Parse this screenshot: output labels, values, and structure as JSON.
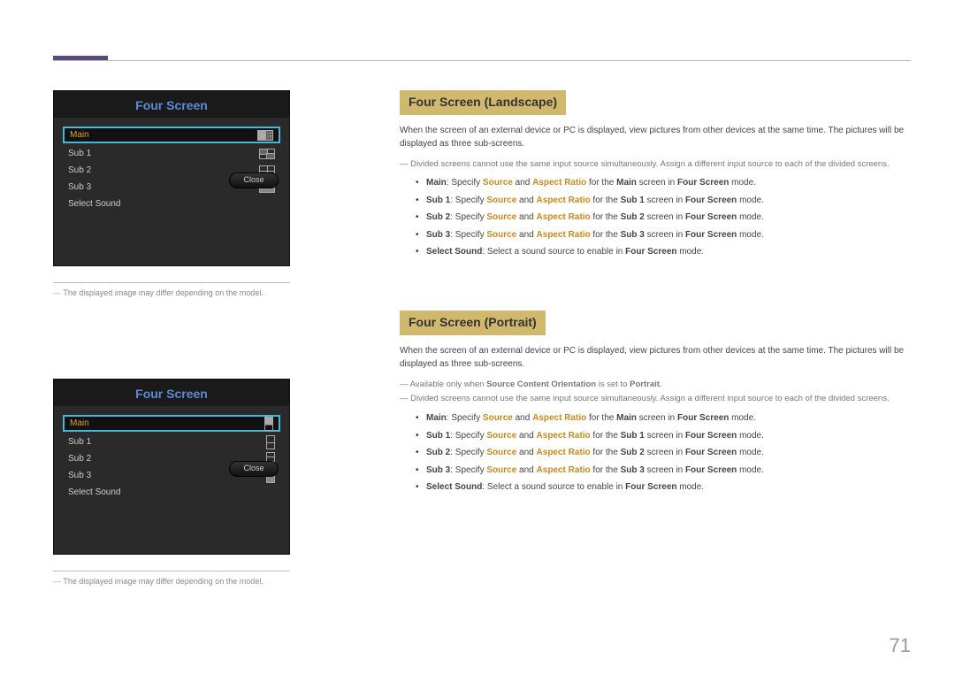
{
  "page_number": "71",
  "osd": {
    "title": "Four Screen",
    "rows": [
      "Main",
      "Sub 1",
      "Sub 2",
      "Sub 3",
      "Select Sound"
    ],
    "close": "Close"
  },
  "caption": "The displayed image may differ depending on the model.",
  "landscape": {
    "heading": "Four Screen (Landscape)",
    "intro": "When the screen of an external device or PC is displayed, view pictures from other devices at the same time. The pictures will be displayed as three sub-screens.",
    "note1": "Divided screens cannot use the same input source simultaneously. Assign a different input source to each of the divided screens.",
    "items": {
      "main_l": "Main",
      "main_t1": ": Specify ",
      "src": "Source",
      "and": " and ",
      "ar": "Aspect Ratio",
      "forthe": " for the ",
      "main_b": "Main",
      "scrin": " screen in ",
      "fs": "Four Screen",
      "mode": " mode.",
      "sub1_l": "Sub 1",
      "sub1_b": "Sub 1",
      "sub2_l": "Sub 2",
      "sub2_b": "Sub 2",
      "sub3_l": "Sub 3",
      "sub3_b": "Sub 3",
      "ss_l": "Select Sound",
      "ss_t": ": Select a sound source to enable in "
    }
  },
  "portrait": {
    "heading": "Four Screen (Portrait)",
    "intro": "When the screen of an external device or PC is displayed, view pictures from other devices at the same time. The pictures will be displayed as three sub-screens.",
    "note0a": "Available only when ",
    "note0b": "Source Content Orientation",
    "note0c": " is set to ",
    "note0d": "Portrait",
    "note0e": ".",
    "note1": "Divided screens cannot use the same input source simultaneously. Assign a different input source to each of the divided screens."
  }
}
